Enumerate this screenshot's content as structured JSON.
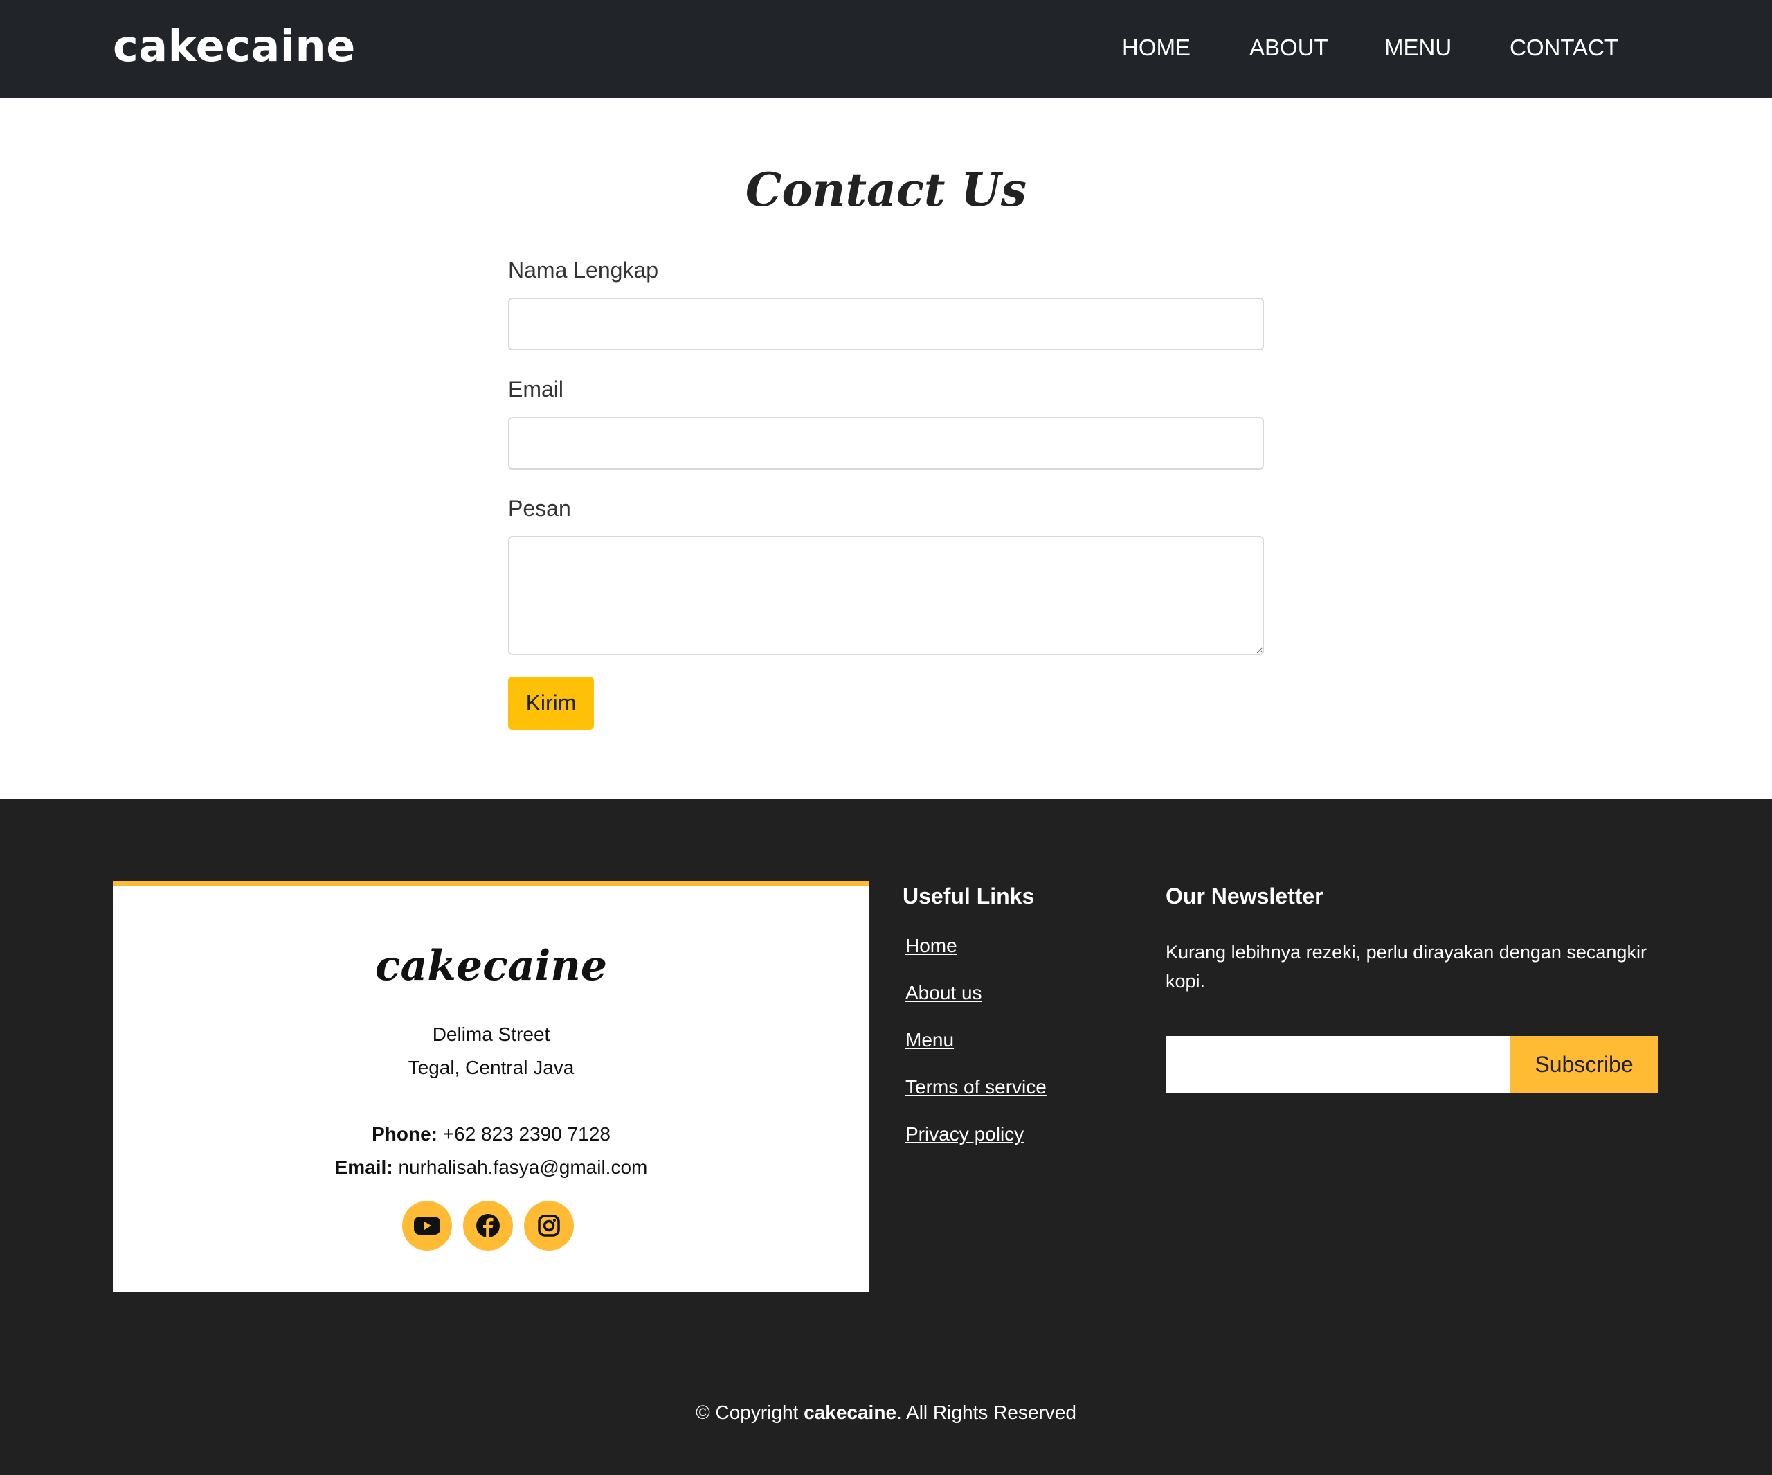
{
  "header": {
    "brand": "cakecaine",
    "nav": [
      {
        "label": "HOME"
      },
      {
        "label": "ABOUT"
      },
      {
        "label": "MENU"
      },
      {
        "label": "CONTACT"
      }
    ]
  },
  "contact": {
    "title": "Contact Us",
    "name_label": "Nama Lengkap",
    "name_value": "",
    "email_label": "Email",
    "email_value": "",
    "message_label": "Pesan",
    "message_value": "",
    "submit_label": "Kirim"
  },
  "footer": {
    "card": {
      "brand": "cakecaine",
      "address_line1": "Delima Street",
      "address_line2": "Tegal, Central Java",
      "phone_label": "Phone:",
      "phone_value": "+62 823 2390 7128",
      "email_label": "Email:",
      "email_value": "nurhalisah.fasya@gmail.com",
      "social": [
        {
          "icon": "youtube-icon"
        },
        {
          "icon": "facebook-icon"
        },
        {
          "icon": "instagram-icon"
        }
      ]
    },
    "useful_links": {
      "title": "Useful Links",
      "links": [
        {
          "label": "Home"
        },
        {
          "label": "About us"
        },
        {
          "label": "Menu"
        },
        {
          "label": "Terms of service"
        },
        {
          "label": "Privacy policy"
        }
      ]
    },
    "newsletter": {
      "title": "Our Newsletter",
      "text": "Kurang lebihnya rezeki, perlu dirayakan dengan secangkir kopi.",
      "input_value": "",
      "button_label": "Subscribe"
    },
    "copyright": {
      "prefix": "© Copyright ",
      "brand": "cakecaine",
      "suffix": ". All Rights Reserved"
    }
  },
  "colors": {
    "header_bg": "#212529",
    "footer_bg": "#212121",
    "accent": "#ffbb33",
    "button_yellow": "#ffc107"
  }
}
